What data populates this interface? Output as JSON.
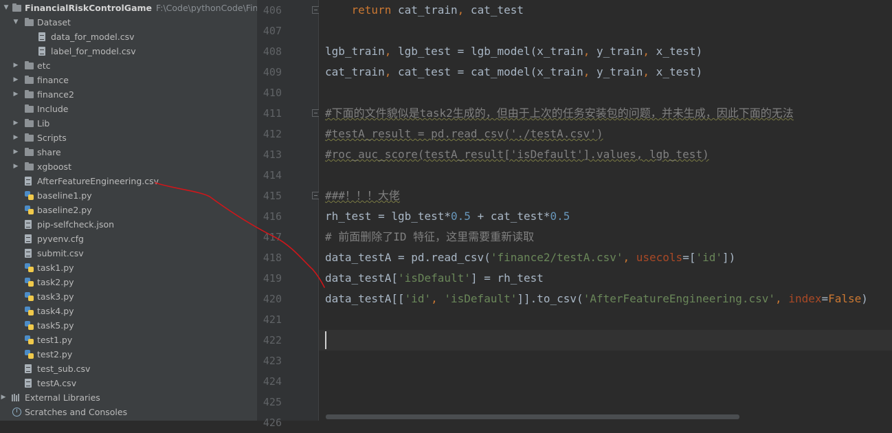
{
  "project": {
    "root": {
      "name": "FinancialRiskControlGame",
      "path": "F:\\Code\\pythonCode\\Financia"
    },
    "items": [
      {
        "label": "Dataset",
        "kind": "folder",
        "depth": 1,
        "expanded": true
      },
      {
        "label": "data_for_model.csv",
        "kind": "file",
        "depth": 2
      },
      {
        "label": "label_for_model.csv",
        "kind": "file",
        "depth": 2
      },
      {
        "label": "etc",
        "kind": "folder",
        "depth": 1,
        "expanded": false
      },
      {
        "label": "finance",
        "kind": "folder",
        "depth": 1,
        "expanded": false
      },
      {
        "label": "finance2",
        "kind": "folder",
        "depth": 1,
        "expanded": false
      },
      {
        "label": "Include",
        "kind": "folder",
        "depth": 1,
        "noarrow": true
      },
      {
        "label": "Lib",
        "kind": "folder",
        "depth": 1,
        "expanded": false
      },
      {
        "label": "Scripts",
        "kind": "folder",
        "depth": 1,
        "expanded": false
      },
      {
        "label": "share",
        "kind": "folder",
        "depth": 1,
        "expanded": false
      },
      {
        "label": "xgboost",
        "kind": "folder",
        "depth": 1,
        "expanded": false
      },
      {
        "label": "AfterFeatureEngineering.csv",
        "kind": "file",
        "depth": 1
      },
      {
        "label": "baseline1.py",
        "kind": "python",
        "depth": 1
      },
      {
        "label": "baseline2.py",
        "kind": "python",
        "depth": 1
      },
      {
        "label": "pip-selfcheck.json",
        "kind": "file",
        "depth": 1
      },
      {
        "label": "pyvenv.cfg",
        "kind": "file",
        "depth": 1
      },
      {
        "label": "submit.csv",
        "kind": "file",
        "depth": 1
      },
      {
        "label": "task1.py",
        "kind": "python",
        "depth": 1
      },
      {
        "label": "task2.py",
        "kind": "python",
        "depth": 1
      },
      {
        "label": "task3.py",
        "kind": "python",
        "depth": 1
      },
      {
        "label": "task4.py",
        "kind": "python",
        "depth": 1
      },
      {
        "label": "task5.py",
        "kind": "python",
        "depth": 1
      },
      {
        "label": "test1.py",
        "kind": "python",
        "depth": 1
      },
      {
        "label": "test2.py",
        "kind": "python",
        "depth": 1
      },
      {
        "label": "test_sub.csv",
        "kind": "file",
        "depth": 1
      },
      {
        "label": "testA.csv",
        "kind": "file",
        "depth": 1
      }
    ],
    "external_libraries": "External Libraries",
    "scratches": "Scratches and Consoles"
  },
  "editor": {
    "line_numbers": [
      "406",
      "407",
      "408",
      "409",
      "410",
      "411",
      "412",
      "413",
      "414",
      "415",
      "416",
      "417",
      "418",
      "419",
      "420",
      "421",
      "422",
      "423",
      "424",
      "425",
      "426"
    ],
    "fold_lines": [
      "406",
      "411",
      "415"
    ],
    "current_line": "422",
    "lines": [
      [
        {
          "t": "    ",
          "c": ""
        },
        {
          "t": "return",
          "c": "kw"
        },
        {
          "t": " cat_train",
          "c": ""
        },
        {
          "t": ",",
          "c": "kw"
        },
        {
          "t": " cat_test",
          "c": ""
        }
      ],
      [],
      [
        {
          "t": "lgb_train",
          "c": ""
        },
        {
          "t": ",",
          "c": "kw"
        },
        {
          "t": " lgb_test = lgb_model(x_train",
          "c": ""
        },
        {
          "t": ",",
          "c": "kw"
        },
        {
          "t": " y_train",
          "c": ""
        },
        {
          "t": ",",
          "c": "kw"
        },
        {
          "t": " x_test)",
          "c": ""
        }
      ],
      [
        {
          "t": "cat_train",
          "c": ""
        },
        {
          "t": ",",
          "c": "kw"
        },
        {
          "t": " cat_test = cat_model(x_train",
          "c": ""
        },
        {
          "t": ",",
          "c": "kw"
        },
        {
          "t": " y_train",
          "c": ""
        },
        {
          "t": ",",
          "c": "kw"
        },
        {
          "t": " x_test)",
          "c": ""
        }
      ],
      [],
      [
        {
          "t": "#下面的文件貌似是task2生成的，但由于上次的任务安装包的问题，并未生成，因此下面的无法",
          "c": "cmt underline"
        }
      ],
      [
        {
          "t": "#testA_result = pd.read_csv('./testA.csv')",
          "c": "cmt underline"
        }
      ],
      [
        {
          "t": "#roc_auc_score(testA_result['isDefault'].values, lgb_test)",
          "c": "cmt underline"
        }
      ],
      [],
      [
        {
          "t": "###！！！大佬",
          "c": "cmt underline"
        }
      ],
      [
        {
          "t": "rh_test = lgb_test*",
          "c": ""
        },
        {
          "t": "0.5",
          "c": "num"
        },
        {
          "t": " + cat_test*",
          "c": ""
        },
        {
          "t": "0.5",
          "c": "num"
        }
      ],
      [
        {
          "t": "# 前面删除了ID 特征，这里需要重新读取",
          "c": "cmt"
        }
      ],
      [
        {
          "t": "data_testA = pd.read_csv(",
          "c": ""
        },
        {
          "t": "'finance2/testA.csv'",
          "c": "str"
        },
        {
          "t": ", ",
          "c": "kw"
        },
        {
          "t": "usecols",
          "c": "named"
        },
        {
          "t": "=[",
          "c": ""
        },
        {
          "t": "'id'",
          "c": "str"
        },
        {
          "t": "])",
          "c": ""
        }
      ],
      [
        {
          "t": "data_testA[",
          "c": ""
        },
        {
          "t": "'isDefault'",
          "c": "str"
        },
        {
          "t": "] = rh_test",
          "c": ""
        }
      ],
      [
        {
          "t": "data_testA[[",
          "c": ""
        },
        {
          "t": "'id'",
          "c": "str"
        },
        {
          "t": ", ",
          "c": "kw"
        },
        {
          "t": "'isDefault'",
          "c": "str"
        },
        {
          "t": "]].to_csv(",
          "c": ""
        },
        {
          "t": "'AfterFeatureEngineering.csv'",
          "c": "str"
        },
        {
          "t": ", ",
          "c": "kw"
        },
        {
          "t": "index",
          "c": "named"
        },
        {
          "t": "=",
          "c": ""
        },
        {
          "t": "False",
          "c": "kw"
        },
        {
          "t": ")",
          "c": ""
        }
      ],
      [],
      [],
      [],
      [],
      [],
      []
    ]
  },
  "colors": {
    "annotation": "#d0161a",
    "selection": "#0d293e"
  }
}
